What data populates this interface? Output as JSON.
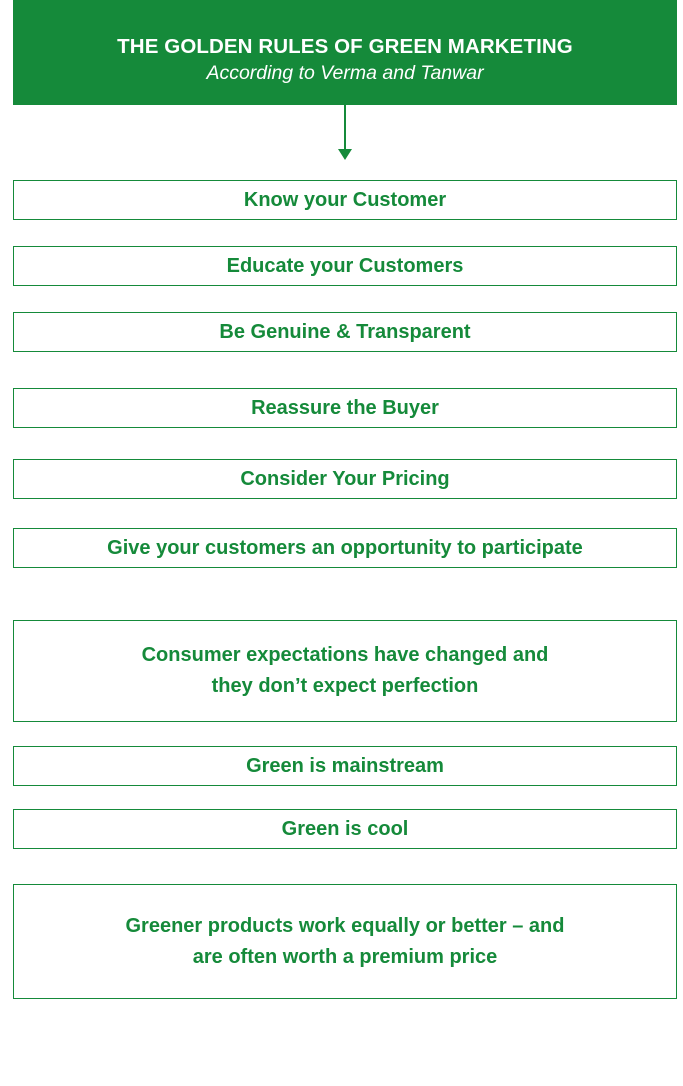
{
  "header": {
    "title": "THE GOLDEN RULES OF GREEN MARKETING",
    "subtitle": "According to Verma and Tanwar"
  },
  "rules": [
    "Know your Customer",
    "Educate your Customers",
    "Be Genuine & Transparent",
    "Reassure the Buyer",
    "Consider Your Pricing",
    "Give your customers an opportunity to participate",
    "Consumer expectations have changed and\nthey don’t expect perfection",
    "Green is mainstream",
    "Green is cool",
    "Greener products work equally or better – and\nare often worth a premium price"
  ],
  "colors": {
    "primary_green": "#158a3a",
    "background": "#ffffff",
    "header_text": "#ffffff"
  }
}
